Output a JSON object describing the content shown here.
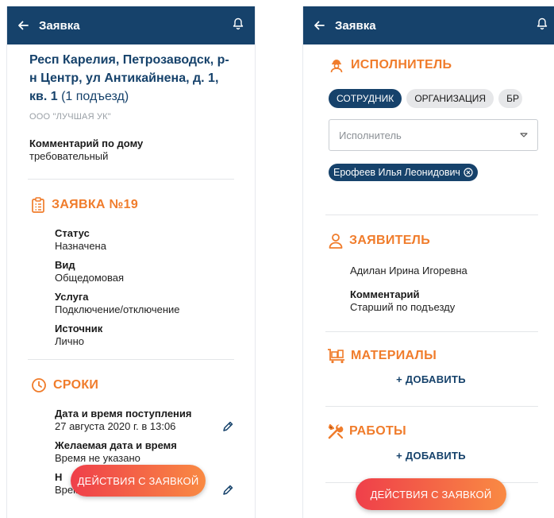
{
  "left": {
    "appbar": {
      "title": "Заявка"
    },
    "address": {
      "main": "Респ Карелия, Петрозаводск, р-н Центр, ул Антикайнена, д. 1, кв. 1",
      "entrance": " (1 подъезд)"
    },
    "org": "ООО \"ЛУЧШАЯ УК\"",
    "house_comment": {
      "label": "Комментарий по дому",
      "value": "требовательный"
    },
    "request": {
      "title": "ЗАЯВКА №19",
      "fields": [
        {
          "label": "Статус",
          "value": "Назначена"
        },
        {
          "label": "Вид",
          "value": "Общедомовая"
        },
        {
          "label": "Услуга",
          "value": "Подключение/отключение"
        },
        {
          "label": "Источник",
          "value": "Лично"
        }
      ]
    },
    "terms": {
      "title": "СРОКИ",
      "fields": [
        {
          "label": "Дата и время поступления",
          "value": "27 августа 2020 г. в 13:06"
        },
        {
          "label": "Желаемая дата и время",
          "value": "Время не указано"
        },
        {
          "label": "Н",
          "value": "Время не указано"
        }
      ]
    },
    "fab": "ДЕЙСТВИЯ С ЗАЯВКОЙ"
  },
  "right": {
    "appbar": {
      "title": "Заявка"
    },
    "executor": {
      "title": "ИСПОЛНИТЕЛЬ",
      "chips": [
        "СОТРУДНИК",
        "ОРГАНИЗАЦИЯ",
        "БР"
      ],
      "select_placeholder": "Исполнитель",
      "selected": "Ерофеев Илья Леонидович"
    },
    "applicant": {
      "title": "ЗАЯВИТЕЛЬ",
      "name": "Адилан Ирина Игоревна",
      "comment_label": "Комментарий",
      "comment_value": "Старший по подъезду"
    },
    "materials": {
      "title": "МАТЕРИАЛЫ",
      "add": "+ ДОБАВИТЬ"
    },
    "works": {
      "title": "РАБОТЫ",
      "add": "+ ДОБАВИТЬ"
    },
    "fab": "ДЕЙСТВИЯ С ЗАЯВКОЙ"
  },
  "colors": {
    "primary": "#16426b",
    "accent": "#f07c2b",
    "fab_start": "#ef3f4a",
    "fab_end": "#f98a43"
  }
}
